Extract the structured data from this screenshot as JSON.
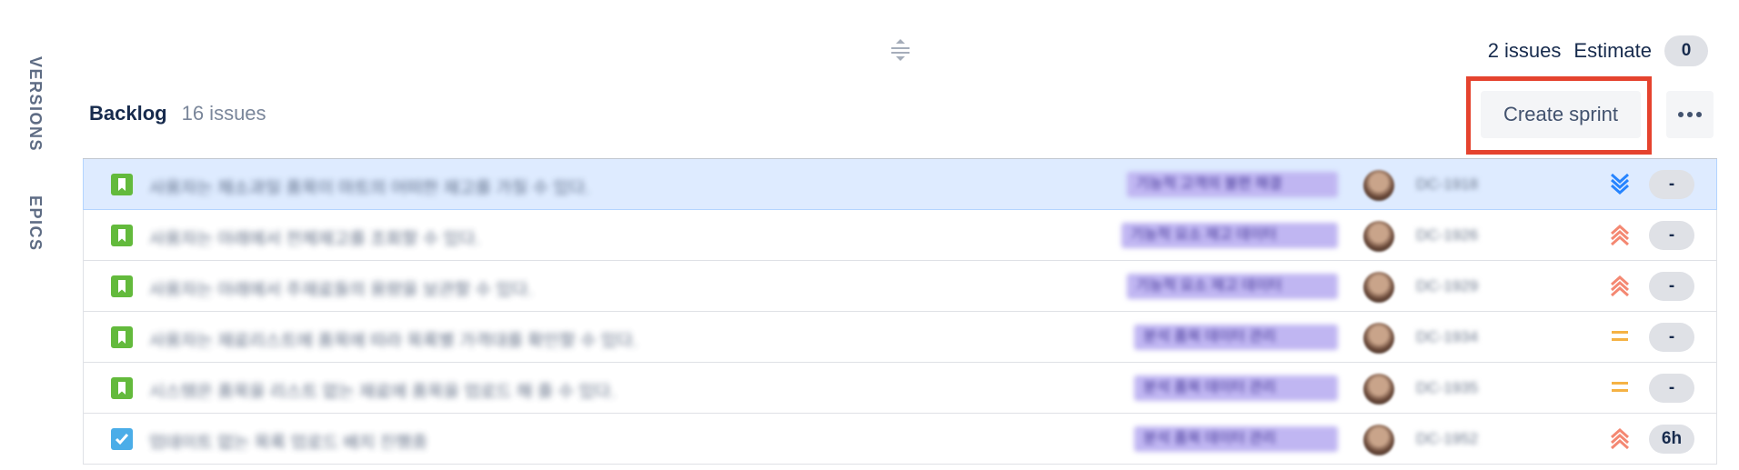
{
  "nav": {
    "versions_label": "VERSIONS",
    "epics_label": "EPICS"
  },
  "sprint_summary": {
    "issues_text": "2 issues",
    "estimate_label": "Estimate",
    "estimate_value": "0"
  },
  "backlog": {
    "title": "Backlog",
    "issue_count": "16 issues",
    "create_sprint_label": "Create sprint",
    "more_label": "•••"
  },
  "issues": [
    {
      "type": "story",
      "summary": "사용자는 채소과일 품목이 마트의 어떠한 재고를 가질 수 있다.",
      "epic": "기능적 고객의 불편 해결",
      "key": "DC-1918",
      "priority": "lowest",
      "estimate": "-",
      "selected": true
    },
    {
      "type": "story",
      "summary": "사용자는 아래에서 전체재고를 조회할 수 있다.",
      "epic": "기능적 요소 재고 데이터",
      "key": "DC-1926",
      "priority": "highest",
      "estimate": "-",
      "selected": false
    },
    {
      "type": "story",
      "summary": "사용자는 아래에서 주재료들의 용량을 보관할 수 있다.",
      "epic": "기능적 요소 재고 데이터",
      "key": "DC-1929",
      "priority": "highest",
      "estimate": "-",
      "selected": false
    },
    {
      "type": "story",
      "summary": "사용자는 재료리스트에 품목에 따라 목록별 가격대를 확인할 수 있다.",
      "epic": "분석 품목 데이터 관리",
      "key": "DC-1934",
      "priority": "medium",
      "estimate": "-",
      "selected": false
    },
    {
      "type": "story",
      "summary": "시스템은 품목을 리스트 없는 재료에 품목을 업로드 해 줄 수 있다.",
      "epic": "분석 품목 데이터 관리",
      "key": "DC-1935",
      "priority": "medium",
      "estimate": "-",
      "selected": false
    },
    {
      "type": "task",
      "summary": "업데이트 없는 목록 업로드 배치 진행중",
      "epic": "분석 품목 데이터 관리",
      "key": "DC-1952",
      "priority": "highest",
      "estimate": "6h",
      "selected": false
    }
  ],
  "colors": {
    "highlight": "#E5432E",
    "selected_row": "#DEEBFF",
    "story": "#63BA3C",
    "task": "#4BADE8",
    "priority_high": "#F48872",
    "priority_medium": "#F5B244",
    "priority_low": "#2684FF"
  }
}
